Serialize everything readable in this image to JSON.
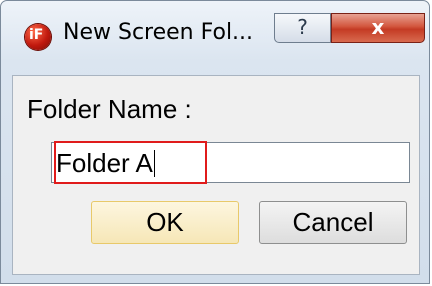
{
  "window": {
    "title": "New Screen Fol..."
  },
  "titlebar": {
    "help_label": "?",
    "close_label": "x"
  },
  "form": {
    "label": "Folder Name :",
    "input_value": "Folder A"
  },
  "buttons": {
    "ok_label": "OK",
    "cancel_label": "Cancel"
  },
  "icons": {
    "app": "app-logo-icon"
  },
  "colors": {
    "highlight": "#e01b1b",
    "close_button": "#c43b24",
    "ok_button": "#f6e7b7"
  }
}
